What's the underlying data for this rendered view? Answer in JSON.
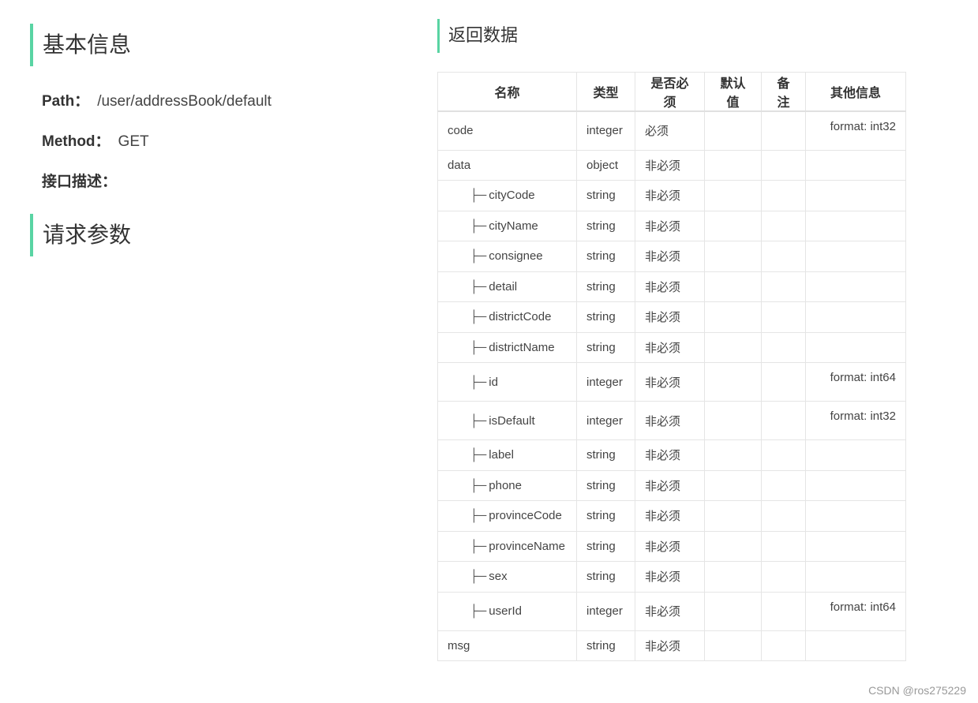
{
  "basic_info": {
    "heading": "基本信息",
    "path_label": "Path：",
    "path_value": "/user/addressBook/default",
    "method_label": "Method：",
    "method_value": "GET",
    "desc_label": "接口描述："
  },
  "request_params": {
    "heading": "请求参数"
  },
  "response": {
    "heading": "返回数据",
    "columns": [
      "名称",
      "类型",
      "是否必须",
      "默认值",
      "备注",
      "其他信息"
    ],
    "tree_prefix": "├─",
    "rows": [
      {
        "name": "code",
        "type": "integer",
        "required": "必须",
        "default": "",
        "note": "",
        "other": "format: int32",
        "child": false
      },
      {
        "name": "data",
        "type": "object",
        "required": "非必须",
        "default": "",
        "note": "",
        "other": "",
        "child": false
      },
      {
        "name": "cityCode",
        "type": "string",
        "required": "非必须",
        "default": "",
        "note": "",
        "other": "",
        "child": true
      },
      {
        "name": "cityName",
        "type": "string",
        "required": "非必须",
        "default": "",
        "note": "",
        "other": "",
        "child": true
      },
      {
        "name": "consignee",
        "type": "string",
        "required": "非必须",
        "default": "",
        "note": "",
        "other": "",
        "child": true
      },
      {
        "name": "detail",
        "type": "string",
        "required": "非必须",
        "default": "",
        "note": "",
        "other": "",
        "child": true
      },
      {
        "name": "districtCode",
        "type": "string",
        "required": "非必须",
        "default": "",
        "note": "",
        "other": "",
        "child": true
      },
      {
        "name": "districtName",
        "type": "string",
        "required": "非必须",
        "default": "",
        "note": "",
        "other": "",
        "child": true
      },
      {
        "name": "id",
        "type": "integer",
        "required": "非必须",
        "default": "",
        "note": "",
        "other": "format: int64",
        "child": true
      },
      {
        "name": "isDefault",
        "type": "integer",
        "required": "非必须",
        "default": "",
        "note": "",
        "other": "format: int32",
        "child": true
      },
      {
        "name": "label",
        "type": "string",
        "required": "非必须",
        "default": "",
        "note": "",
        "other": "",
        "child": true
      },
      {
        "name": "phone",
        "type": "string",
        "required": "非必须",
        "default": "",
        "note": "",
        "other": "",
        "child": true
      },
      {
        "name": "provinceCode",
        "type": "string",
        "required": "非必须",
        "default": "",
        "note": "",
        "other": "",
        "child": true
      },
      {
        "name": "provinceName",
        "type": "string",
        "required": "非必须",
        "default": "",
        "note": "",
        "other": "",
        "child": true
      },
      {
        "name": "sex",
        "type": "string",
        "required": "非必须",
        "default": "",
        "note": "",
        "other": "",
        "child": true
      },
      {
        "name": "userId",
        "type": "integer",
        "required": "非必须",
        "default": "",
        "note": "",
        "other": "format: int64",
        "child": true
      },
      {
        "name": "msg",
        "type": "string",
        "required": "非必须",
        "default": "",
        "note": "",
        "other": "",
        "child": false
      }
    ]
  },
  "watermark": "CSDN @ros275229",
  "colors": {
    "accent": "#59d4a3",
    "border": "#e5e5e5",
    "text": "#333333"
  }
}
